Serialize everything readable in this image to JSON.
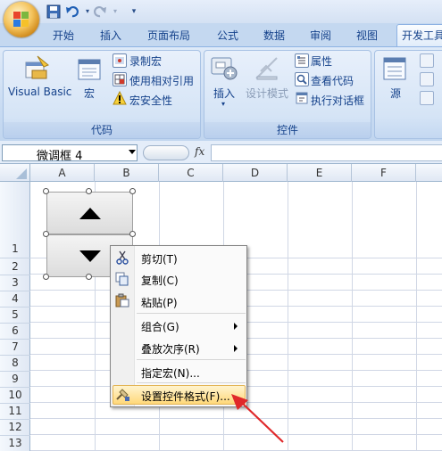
{
  "tabs": [
    "开始",
    "插入",
    "页面布局",
    "公式",
    "数据",
    "审阅",
    "视图",
    "开发工具"
  ],
  "ribbon": {
    "code": {
      "label": "代码",
      "visual_basic": "Visual Basic",
      "macros": "宏",
      "record_macro": "录制宏",
      "relative_ref": "使用相对引用",
      "macro_security": "宏安全性"
    },
    "controls": {
      "label": "控件",
      "insert": "插入",
      "design_mode": "设计模式",
      "properties": "属性",
      "view_code": "查看代码",
      "run_dialog": "执行对话框"
    },
    "xml": {
      "source": "源"
    }
  },
  "namebox": {
    "value": "微调框 4"
  },
  "formula": {
    "fx": "fx",
    "value": ""
  },
  "columns": [
    "A",
    "B",
    "C",
    "D",
    "E",
    "F"
  ],
  "rows": [
    "1",
    "2",
    "3",
    "4",
    "5",
    "6",
    "7",
    "8",
    "9",
    "10",
    "11",
    "12",
    "13"
  ],
  "context_menu": {
    "cut": "剪切(T)",
    "copy": "复制(C)",
    "paste": "粘贴(P)",
    "group": "组合(G)",
    "order": "叠放次序(R)",
    "assign_macro": "指定宏(N)...",
    "format_control": "设置控件格式(F)..."
  },
  "colors": {
    "accent": "#15428b",
    "highlight": "#ffd87a",
    "arrow": "#e0282a"
  }
}
